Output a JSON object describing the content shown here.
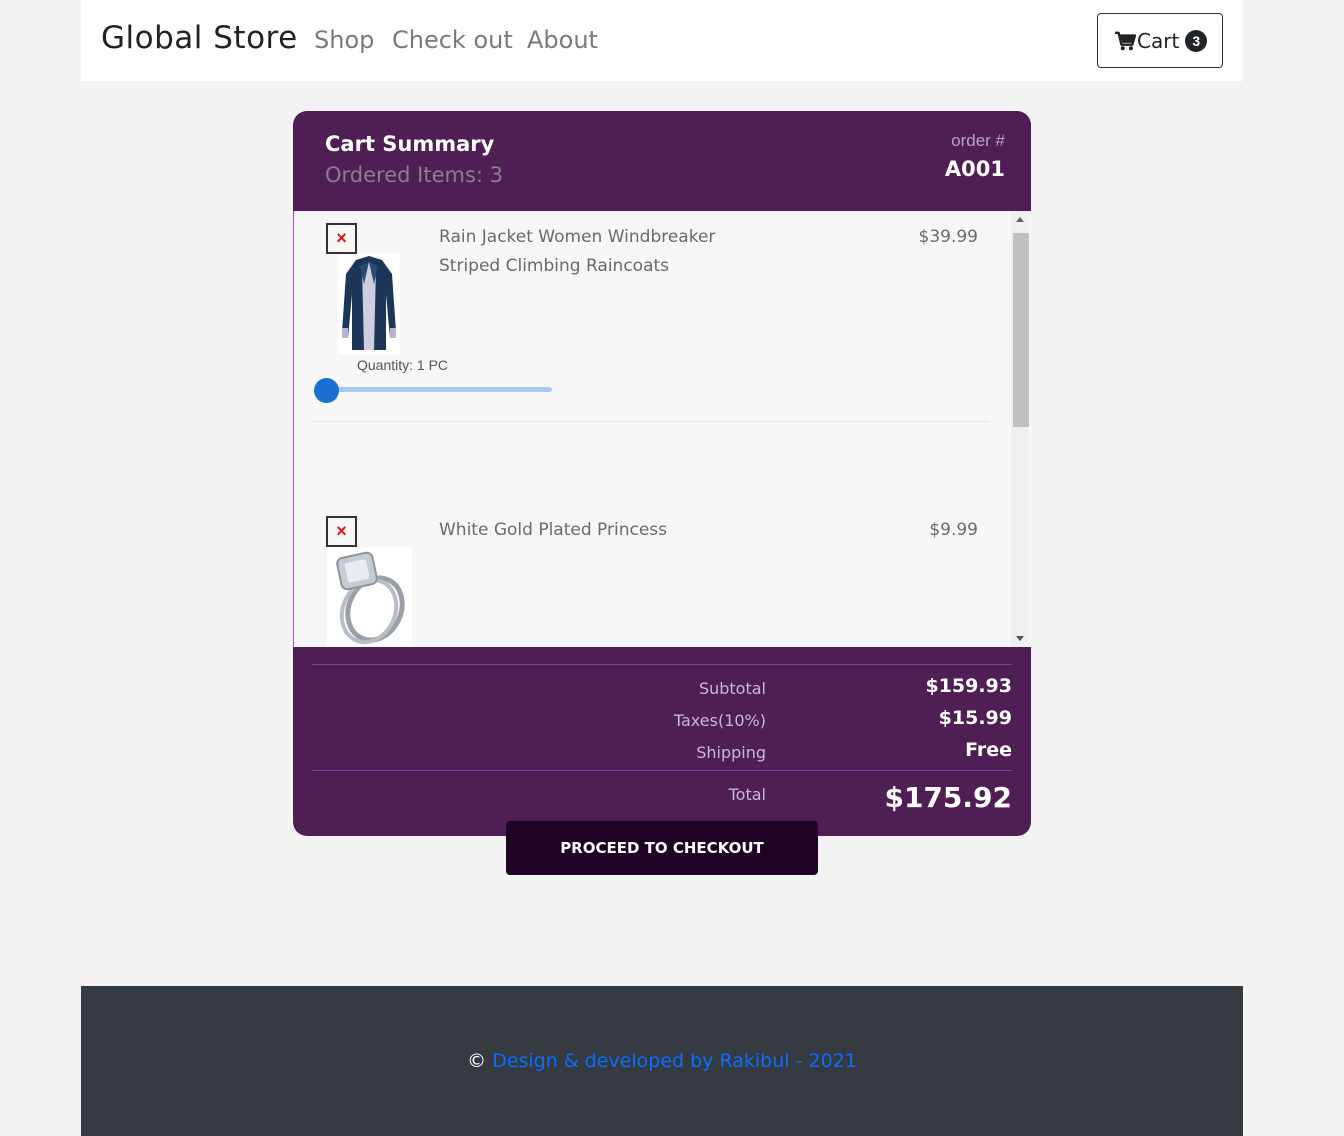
{
  "nav": {
    "brand": "Global Store",
    "links": [
      "Shop",
      "Check out",
      "About"
    ],
    "cart_label": "Cart",
    "cart_count": "3"
  },
  "cart_summary": {
    "title": "Cart Summary",
    "ordered_items": "Ordered Items: 3",
    "order_label": "order #",
    "order_number": "A001",
    "items": [
      {
        "name": "Rain Jacket Women Windbreaker Striped Climbing Raincoats",
        "price": "$39.99",
        "quantity_label": "Quantity: 1 PC",
        "quantity_value": 1,
        "remove_symbol": "×"
      },
      {
        "name": "White Gold Plated Princess",
        "price": "$9.99",
        "remove_symbol": "×"
      }
    ],
    "subtotal_label": "Subtotal",
    "subtotal": "$159.93",
    "taxes_label": "Taxes(10%)",
    "taxes": "$15.99",
    "shipping_label": "Shipping",
    "shipping": "Free",
    "total_label": "Total",
    "total": "$175.92"
  },
  "checkout_button": "PROCEED TO CHECKOUT",
  "footer": {
    "copyright_symbol": "©",
    "link_text": "Design & developed by Rakibul - 2021"
  },
  "colors": {
    "card_bg": "#4f1e55",
    "checkout_bg": "#1e0325",
    "footer_bg": "#343a40",
    "link": "#0d6efd",
    "remove": "#e0121b",
    "slider": "#1a6fd1"
  },
  "icons": [
    "cart-icon",
    "close-icon",
    "jacket-image",
    "ring-image"
  ]
}
